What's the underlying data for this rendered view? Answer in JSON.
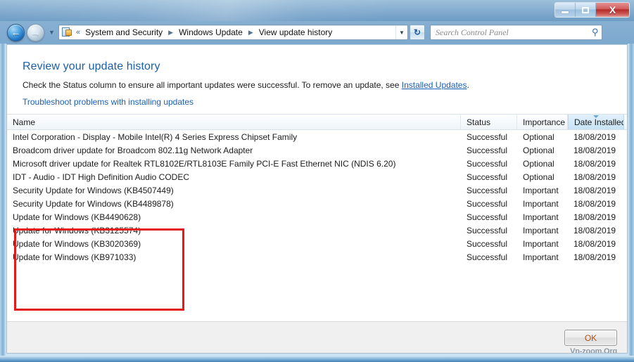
{
  "window": {
    "caption_buttons": {
      "minimize_label": "Minimize",
      "maximize_label": "Maximize",
      "close_label": "X"
    }
  },
  "navbar": {
    "back_arrow": "←",
    "forward_arrow": "→",
    "recent_chevron": "▼",
    "breadcrumb_icon": "control-panel-icon",
    "breadcrumb_overflow": "«",
    "breadcrumbs": [
      {
        "label": "System and Security"
      },
      {
        "label": "Windows Update"
      },
      {
        "label": "View update history"
      }
    ],
    "breadcrumb_separator": "▶",
    "address_dropdown": "▼",
    "refresh_label": "↻",
    "search": {
      "placeholder": "Search Control Panel",
      "value": "",
      "icon": "⚲"
    }
  },
  "content": {
    "title": "Review your update history",
    "description_before_link": "Check the Status column to ensure all important updates were successful. To remove an update, see ",
    "description_link": "Installed Updates",
    "description_after_link": ".",
    "troubleshoot_link": "Troubleshoot problems with installing updates"
  },
  "list": {
    "columns": [
      {
        "key": "name",
        "label": "Name",
        "sorted": false
      },
      {
        "key": "status",
        "label": "Status",
        "sorted": false
      },
      {
        "key": "importance",
        "label": "Importance",
        "sorted": false
      },
      {
        "key": "date",
        "label": "Date Installed",
        "sorted": true,
        "sort_direction": "ascending"
      }
    ],
    "rows": [
      {
        "name": "Intel Corporation - Display - Mobile Intel(R) 4 Series Express Chipset Family",
        "status": "Successful",
        "importance": "Optional",
        "date": "18/08/2019"
      },
      {
        "name": "Broadcom driver update for Broadcom 802.11g Network Adapter",
        "status": "Successful",
        "importance": "Optional",
        "date": "18/08/2019"
      },
      {
        "name": "Microsoft driver update for Realtek RTL8102E/RTL8103E Family PCI-E Fast Ethernet NIC (NDIS 6.20)",
        "status": "Successful",
        "importance": "Optional",
        "date": "18/08/2019"
      },
      {
        "name": "IDT - Audio - IDT High Definition Audio CODEC",
        "status": "Successful",
        "importance": "Optional",
        "date": "18/08/2019"
      },
      {
        "name": "Security Update for Windows (KB4507449)",
        "status": "Successful",
        "importance": "Important",
        "date": "18/08/2019"
      },
      {
        "name": "Security Update for Windows (KB4489878)",
        "status": "Successful",
        "importance": "Important",
        "date": "18/08/2019"
      },
      {
        "name": "Update for Windows (KB4490628)",
        "status": "Successful",
        "importance": "Important",
        "date": "18/08/2019"
      },
      {
        "name": "Update for Windows (KB3125574)",
        "status": "Successful",
        "importance": "Important",
        "date": "18/08/2019"
      },
      {
        "name": "Update for Windows (KB3020369)",
        "status": "Successful",
        "importance": "Important",
        "date": "18/08/2019"
      },
      {
        "name": "Update for Windows (KB971033)",
        "status": "Successful",
        "importance": "Important",
        "date": "18/08/2019"
      }
    ]
  },
  "annotation": {
    "color": "#e21b1b",
    "highlighted_row_count": 6
  },
  "footer": {
    "ok_label": "OK",
    "watermark": "Vn-zoom.Org"
  }
}
